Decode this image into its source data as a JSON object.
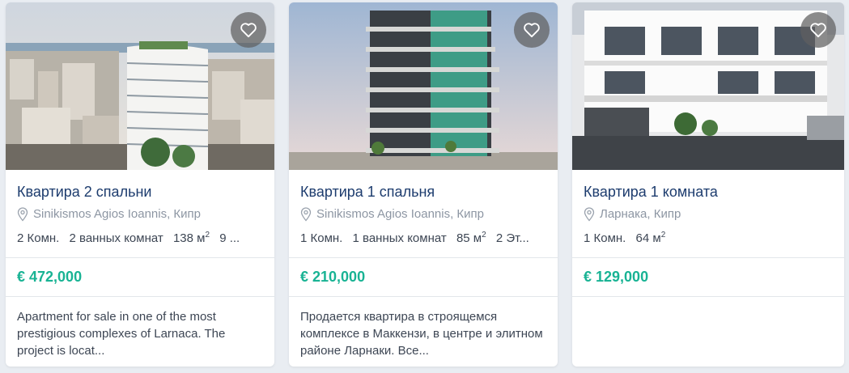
{
  "cards": [
    {
      "title": "Квартира 2 спальни",
      "location": "Sinikismos Agios Ioannis, Кипр",
      "specs": {
        "rooms": "2 Комн.",
        "baths": "2 ванных комнат",
        "area": "138 м",
        "area_sup": "2",
        "extra": "9 ..."
      },
      "price": "€ 472,000",
      "description": "Apartment for sale in one of the most prestigious complexes of Larnaca. The project is locat...",
      "photo_icon": "curved-tower-photo"
    },
    {
      "title": "Квартира 1 спальня",
      "location": "Sinikismos Agios Ioannis, Кипр",
      "specs": {
        "rooms": "1 Комн.",
        "baths": "1 ванных комнат",
        "area": "85 м",
        "area_sup": "2",
        "extra": "2 Эт..."
      },
      "price": "€ 210,000",
      "description": "Продается квартира в строящемся комплексе в Маккензи, в центре и элитном районе Ларнаки. Все...",
      "photo_icon": "glass-tower-photo"
    },
    {
      "title": "Квартира 1 комната",
      "location": "Ларнака, Кипр",
      "specs": {
        "rooms": "1 Комн.",
        "area": "64 м",
        "area_sup": "2"
      },
      "price": "€ 129,000",
      "description": "",
      "photo_icon": "low-rise-building-photo"
    }
  ],
  "colors": {
    "price": "#19b394",
    "title": "#1d3c6e",
    "muted": "#8d96a3"
  },
  "icons": {
    "favorite": "heart-icon",
    "location": "map-pin-icon"
  }
}
